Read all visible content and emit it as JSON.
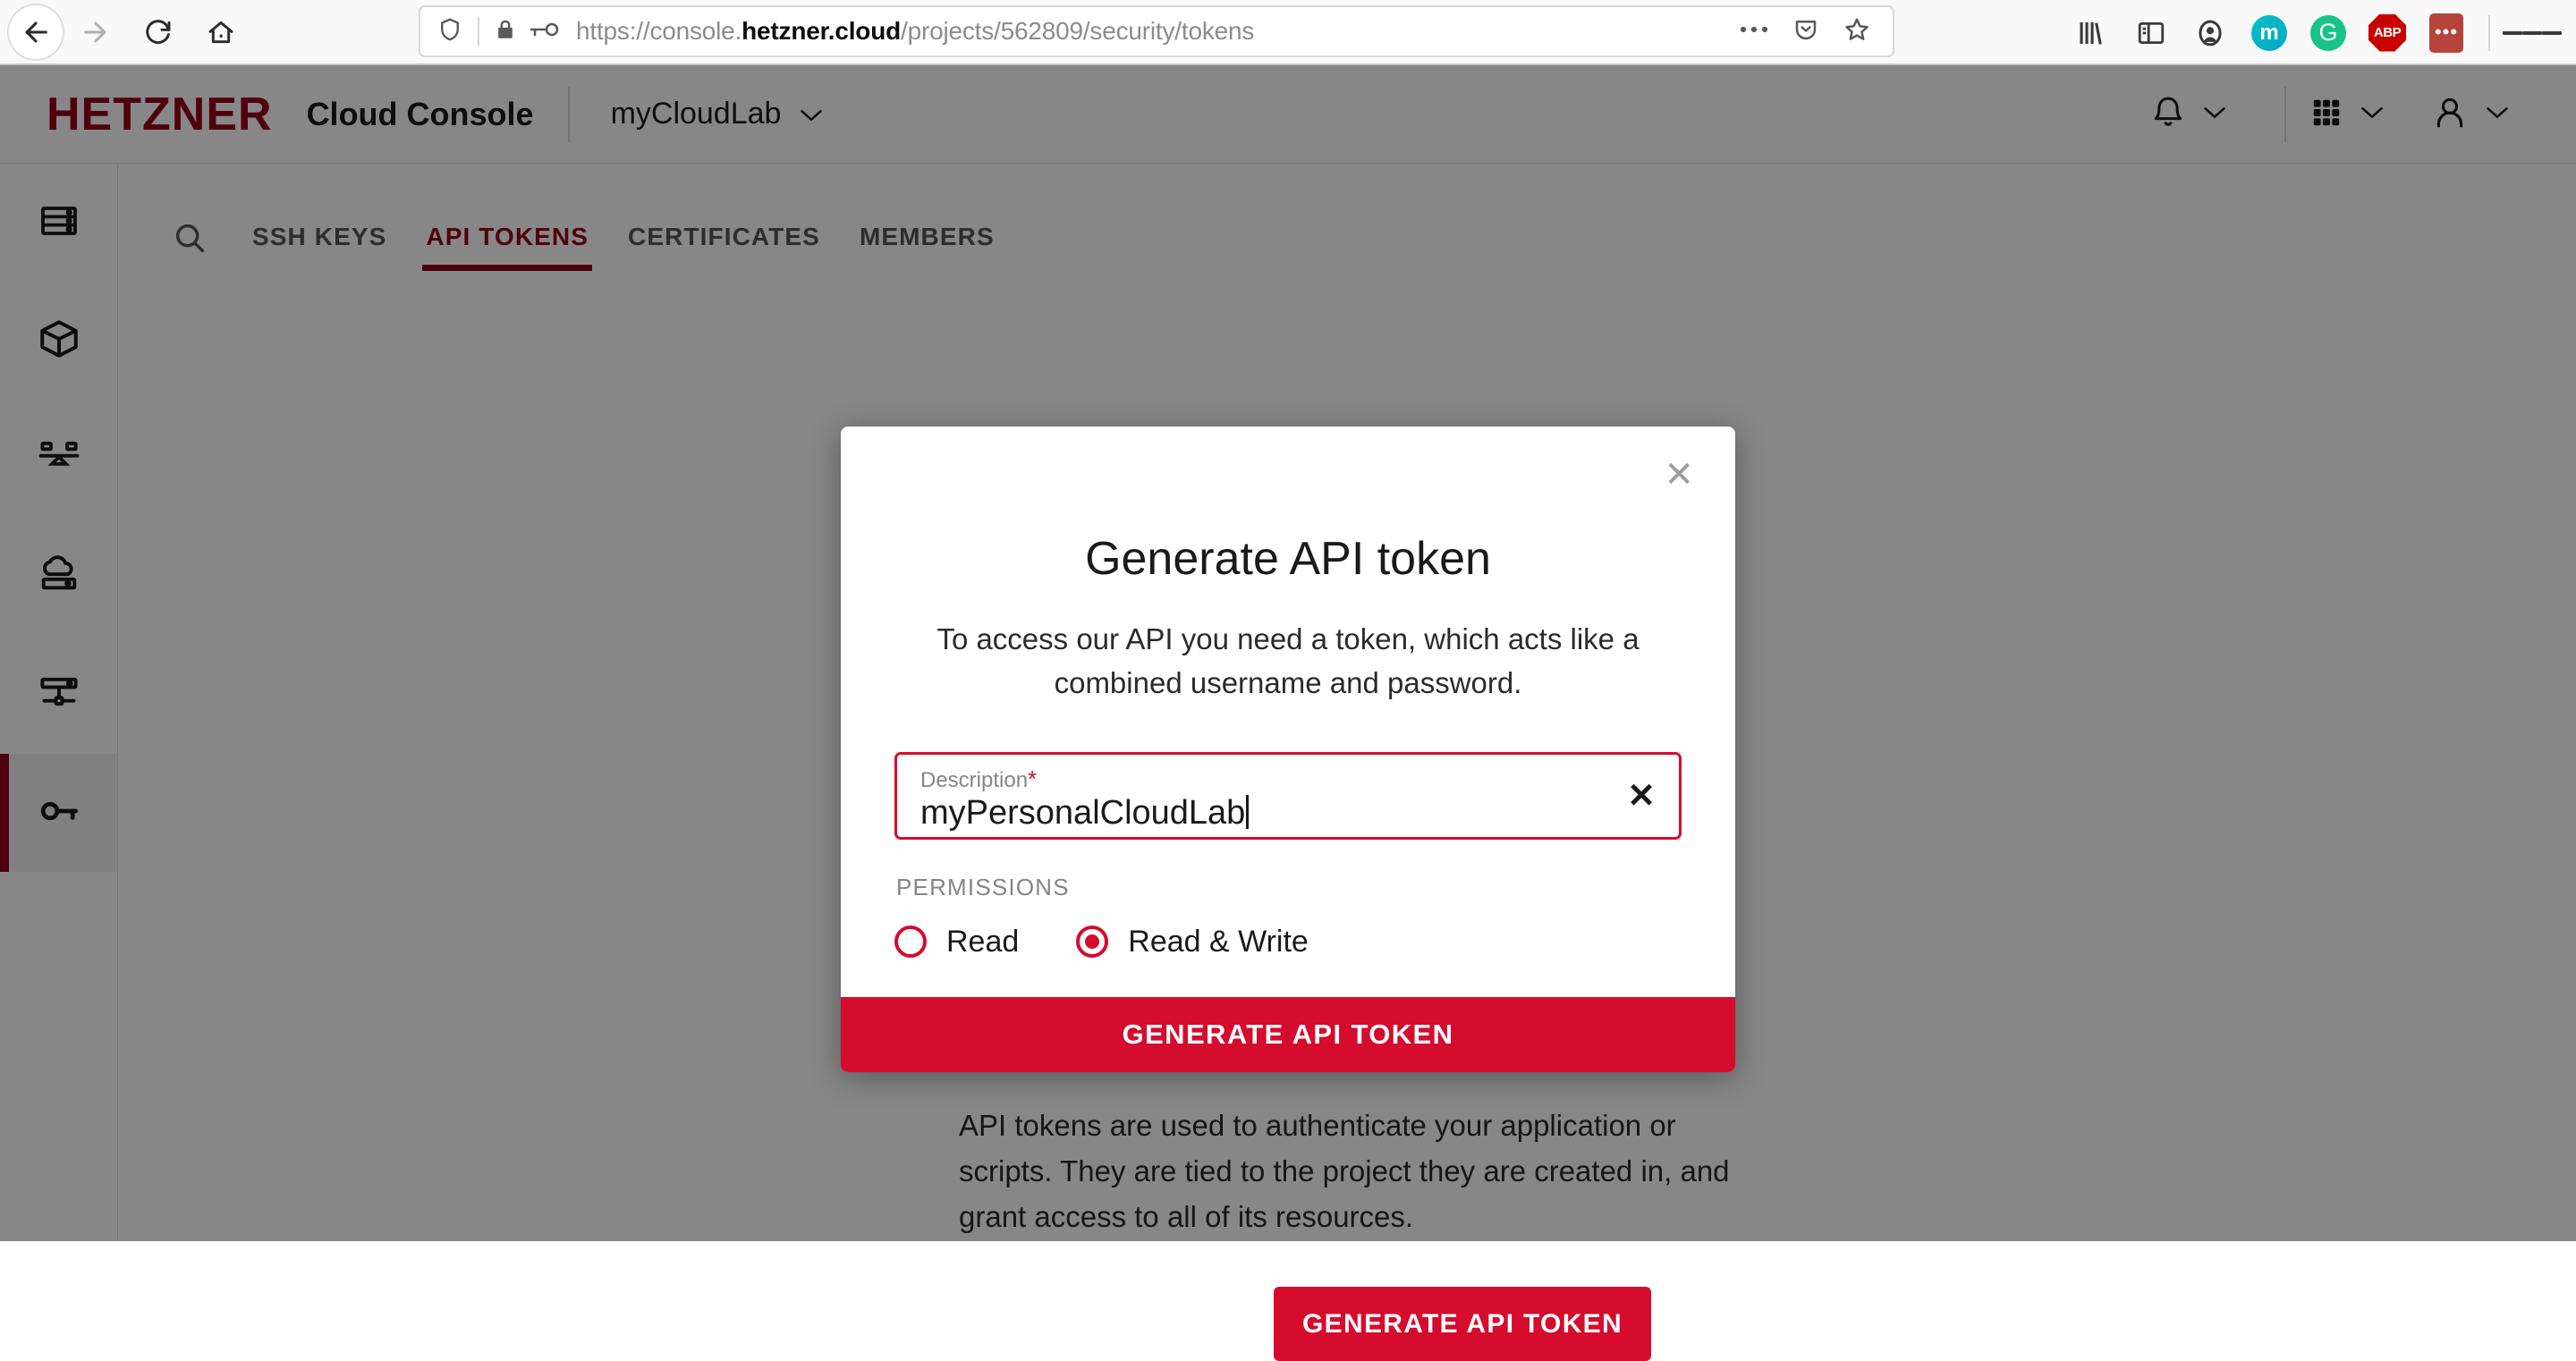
{
  "browser": {
    "nav": {
      "back_icon": "back-arrow-icon",
      "forward_icon": "forward-arrow-icon",
      "reload_icon": "reload-icon",
      "home_icon": "home-icon"
    },
    "url": {
      "prefix": "https://console.",
      "host": "hetzner.cloud",
      "path": "/projects/562809/security/tokens",
      "full": "https://console.hetzner.cloud/projects/562809/security/tokens",
      "shield_icon": "tracking-protection-shield-icon",
      "lock_icon": "padlock-icon",
      "key_icon": "saved-login-key-icon",
      "more_icon": "page-actions-ellipsis-icon",
      "pocket_icon": "pocket-save-icon",
      "bookmark_icon": "bookmark-star-icon"
    },
    "toolbar_icons": [
      {
        "name": "library-icon",
        "label": ""
      },
      {
        "name": "sidebar-toggle-icon",
        "label": ""
      },
      {
        "name": "account-icon",
        "label": ""
      },
      {
        "name": "extension-m-icon",
        "label": "m"
      },
      {
        "name": "extension-grammarly-icon",
        "label": "G"
      },
      {
        "name": "extension-adblockplus-icon",
        "label": "ABP"
      },
      {
        "name": "extension-dots-icon",
        "label": "•••"
      },
      {
        "name": "app-menu-icon",
        "label": ""
      }
    ]
  },
  "app": {
    "logo": "HETZNER",
    "title": "Cloud Console",
    "project": "myCloudLab",
    "header_icons": {
      "notifications": "bell-icon",
      "apps": "grid-apps-icon",
      "user": "user-avatar-icon",
      "chevron": "chevron-down-icon"
    },
    "sidebar": [
      {
        "name": "sidebar-item-servers",
        "icon": "server-rack-icon",
        "active": false
      },
      {
        "name": "sidebar-item-volumes",
        "icon": "cube-icon",
        "active": false
      },
      {
        "name": "sidebar-item-load-balancers",
        "icon": "load-balancer-icon",
        "active": false
      },
      {
        "name": "sidebar-item-storage-boxes",
        "icon": "cloud-storage-icon",
        "active": false
      },
      {
        "name": "sidebar-item-networks",
        "icon": "network-icon",
        "active": false
      },
      {
        "name": "sidebar-item-security",
        "icon": "key-icon",
        "active": true
      }
    ],
    "search_icon": "search-icon",
    "tabs": [
      {
        "label": "SSH KEYS",
        "active": false
      },
      {
        "label": "API TOKENS",
        "active": true
      },
      {
        "label": "CERTIFICATES",
        "active": false
      },
      {
        "label": "MEMBERS",
        "active": false
      }
    ],
    "background": {
      "paragraph_line1": "API tokens are used to authenticate your application or",
      "paragraph_line2": "scripts. They are tied to the project they are created in, and",
      "paragraph_line3": "grant access to all of its resources.",
      "generate_button": "GENERATE API TOKEN"
    }
  },
  "modal": {
    "title": "Generate API token",
    "description": "To access our API you need a token, which acts like a combined username and password.",
    "close_icon": "close-icon",
    "field": {
      "label": "Description",
      "required_marker": "*",
      "value": "myPersonalCloudLab",
      "placeholder": "Description",
      "clear_icon": "clear-input-icon"
    },
    "permissions": {
      "label": "PERMISSIONS",
      "options": [
        {
          "label": "Read",
          "selected": false
        },
        {
          "label": "Read & Write",
          "selected": true
        }
      ]
    },
    "submit_label": "GENERATE API TOKEN"
  },
  "colors": {
    "brand_red": "#98001a",
    "accent_red": "#d50c2d",
    "text_dark": "#1a1a1a",
    "text_muted": "#858585",
    "chrome_bg": "#f9f9fa"
  }
}
